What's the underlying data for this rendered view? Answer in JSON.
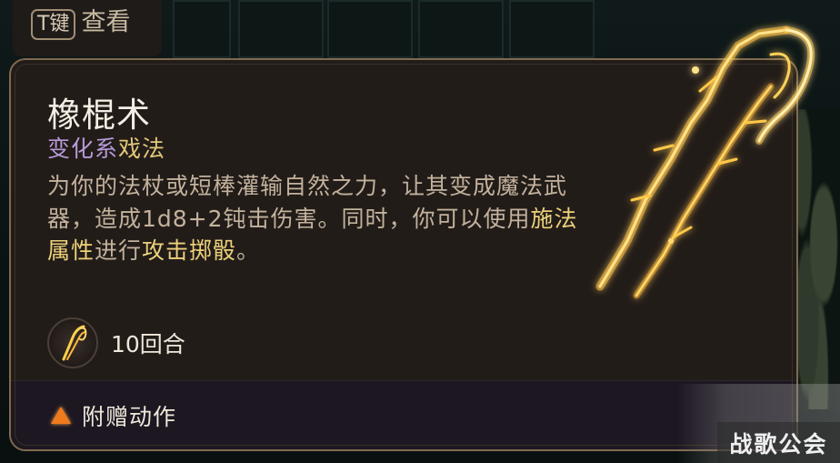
{
  "key_hint": {
    "key": "T键",
    "label": "查看"
  },
  "spell": {
    "name": "橡棍术",
    "school": "变化系",
    "level": "戏法",
    "description": {
      "part1": "为你的法杖或短棒灌输自然之力，让其变成魔法武器，造成1d8+2钝击伤害。同时，你可以使用",
      "highlight1": "施法属性",
      "part2": "进行",
      "highlight2": "攻击掷骰",
      "part3": "。"
    },
    "duration": "10回合",
    "action_type": "附赠动作"
  },
  "watermark": "战歌公会",
  "colors": {
    "panel_bg": "#221c19",
    "panel_border": "#7f6a4f",
    "school": "#b79bd8",
    "highlight": "#ecd17a",
    "bonus_action_icon": "#f07a1e",
    "weapon_glow": "#ffd35a"
  },
  "icons": {
    "duration": "shillelagh-spell-icon",
    "action": "bonus-action-triangle-icon",
    "art": "glowing-shillelagh-illustration"
  }
}
